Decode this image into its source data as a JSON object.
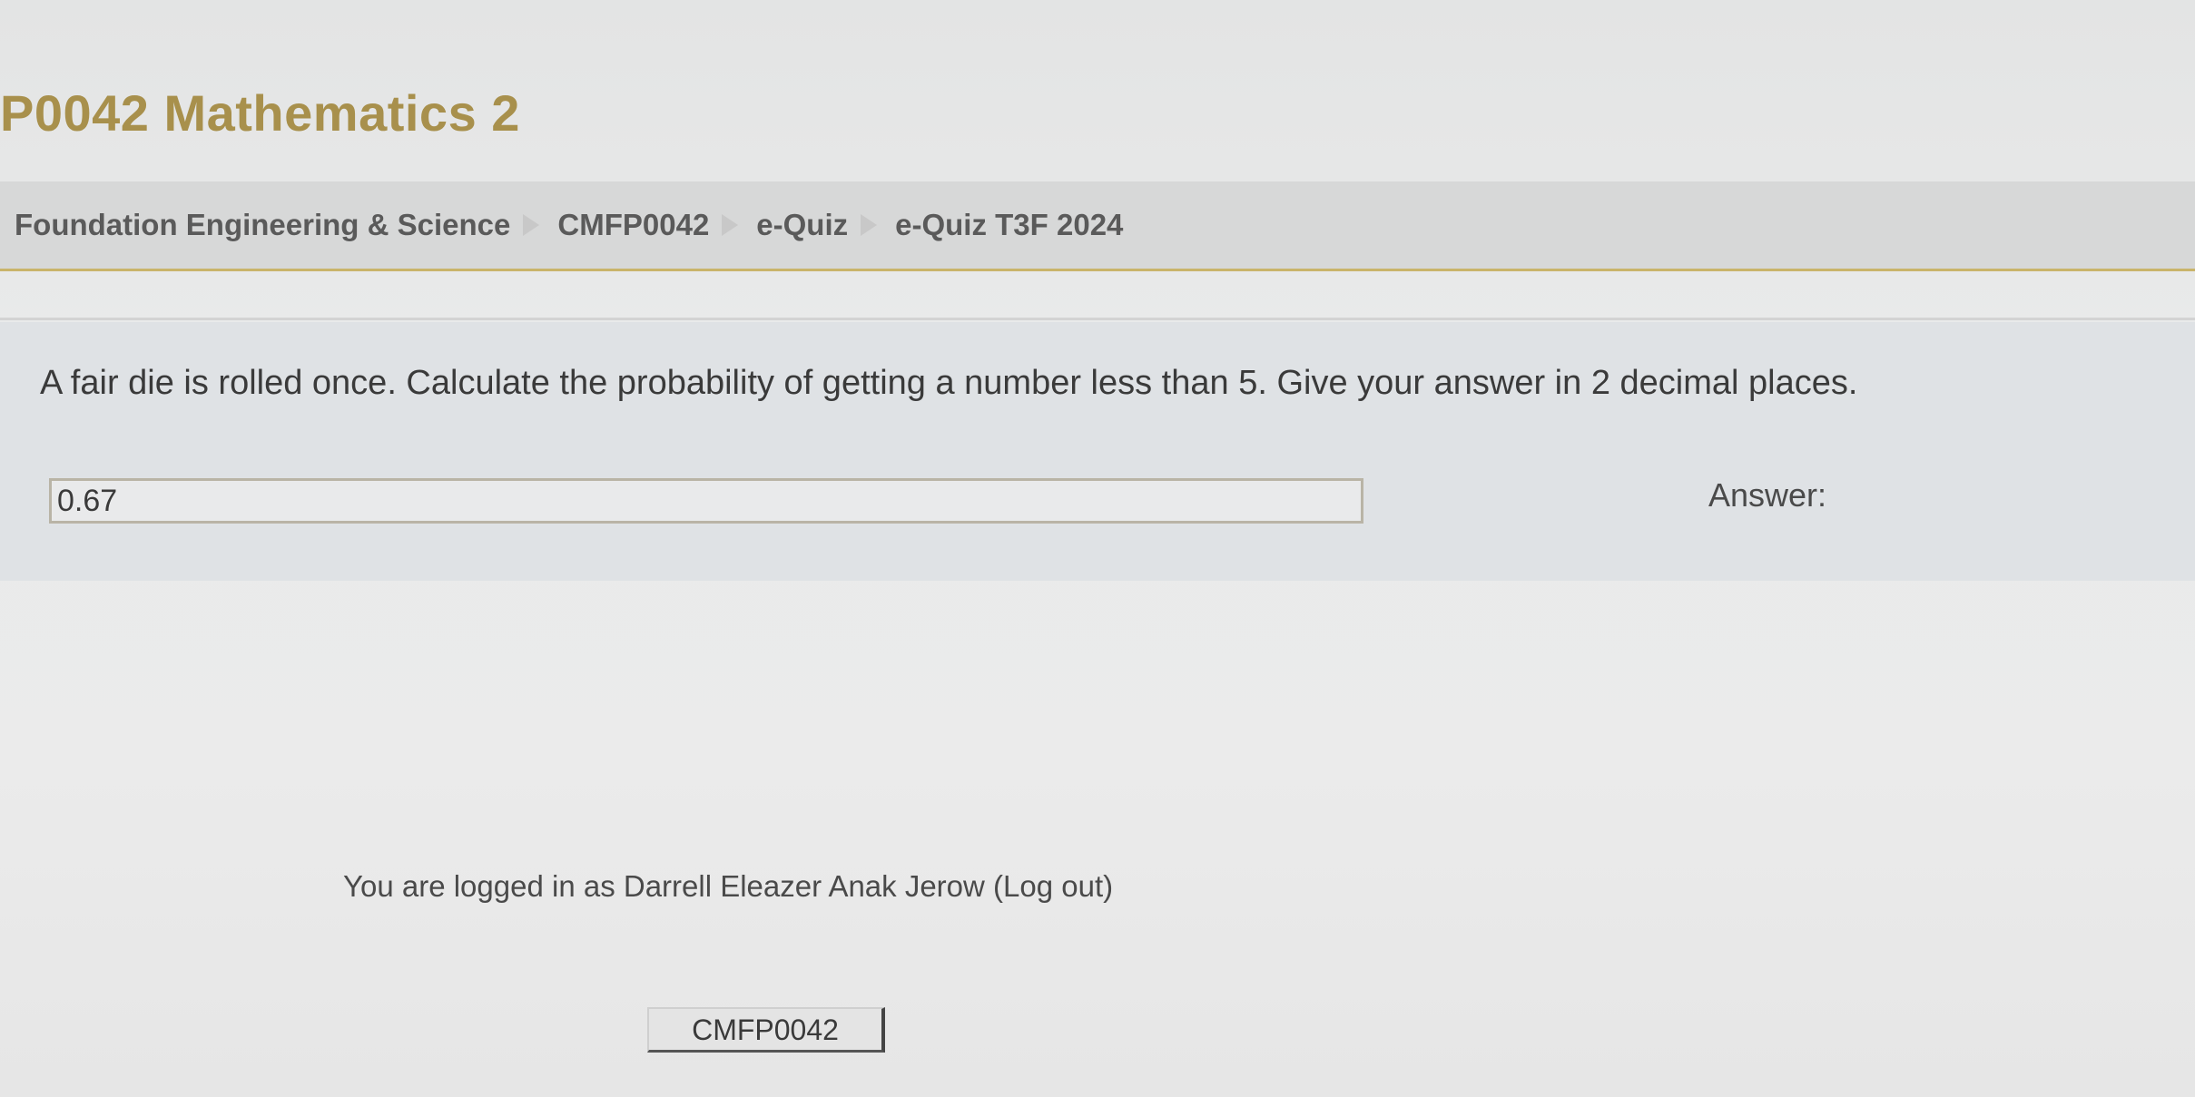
{
  "header": {
    "course_title": "P0042 Mathematics 2"
  },
  "breadcrumb": {
    "items": [
      {
        "label": "Foundation Engineering & Science"
      },
      {
        "label": "CMFP0042"
      },
      {
        "label": "e-Quiz"
      },
      {
        "label": "e-Quiz T3F 2024"
      }
    ],
    "separator_icon": "triangle-right-icon"
  },
  "question": {
    "text": "A fair die is rolled once. Calculate the probability of getting a number less than 5. Give your answer in 2 decimal places.",
    "answer_value": "0.67",
    "answer_label": "Answer:"
  },
  "footer": {
    "login_prefix": "You are logged in as Darrell Eleazer Anak Jerow ",
    "logout_link": "(Log out)",
    "course_button": "CMFP0042"
  },
  "colors": {
    "title": "#a8904c",
    "accent_border": "#c9b46a",
    "background": "#e6e7e7"
  }
}
